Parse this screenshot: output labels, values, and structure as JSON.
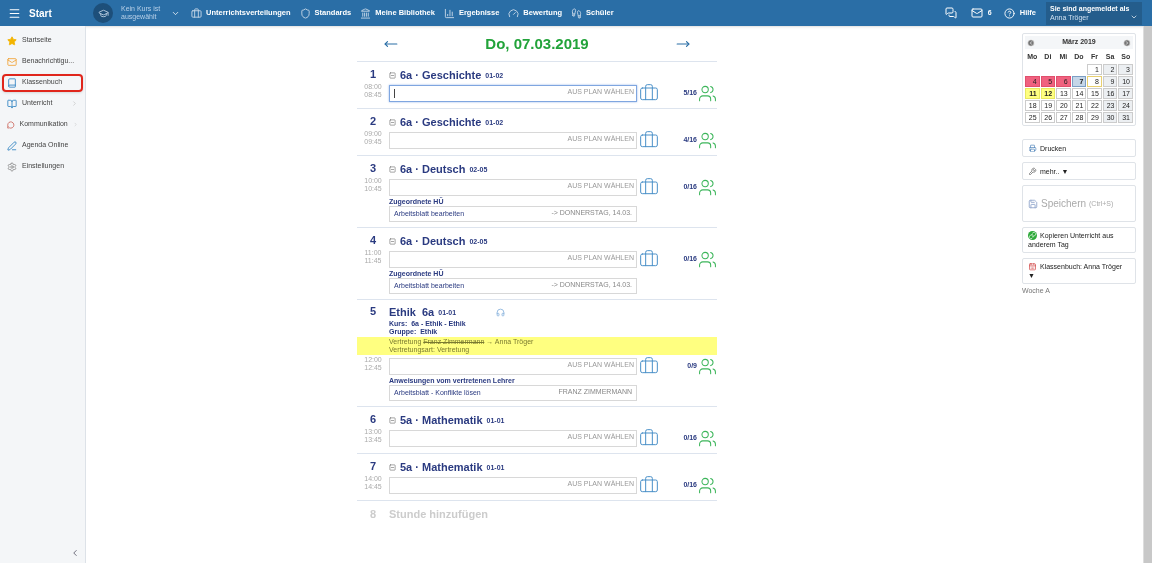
{
  "topbar": {
    "menu_label": "Start",
    "course_selector": "Kein Kurs ist ausgewählt",
    "nav": [
      {
        "label": "Unterrichtsverteilungen"
      },
      {
        "label": "Standards"
      },
      {
        "label": "Meine Bibliothek"
      },
      {
        "label": "Ergebnisse"
      },
      {
        "label": "Bewertung"
      },
      {
        "label": "Schüler"
      }
    ],
    "messages_count": "6",
    "help": "Hilfe",
    "user": {
      "caption": "Sie sind angemeldet als",
      "name": "Anna Tröger"
    }
  },
  "sidebar": {
    "items": [
      {
        "label": "Startseite",
        "selected": false,
        "has_submenu": false
      },
      {
        "label": "Benachrichtigu...",
        "selected": false,
        "has_submenu": false
      },
      {
        "label": "Klassenbuch",
        "selected": true,
        "has_submenu": false
      },
      {
        "label": "Unterricht",
        "selected": false,
        "has_submenu": true
      },
      {
        "label": "Kommunikation",
        "selected": false,
        "has_submenu": true
      },
      {
        "label": "Agenda Online",
        "selected": false,
        "has_submenu": false
      },
      {
        "label": "Einstellungen",
        "selected": false,
        "has_submenu": false
      }
    ]
  },
  "day": {
    "date": "Do, 07.03.2019"
  },
  "lessons": [
    {
      "kind": "regular",
      "number": "1",
      "start": "08:00",
      "end": "08:45",
      "title": "6a · Geschichte",
      "code": "01-02",
      "plan_placeholder": "AUS PLAN WÄHLEN",
      "focused": true,
      "attendance": "5/16"
    },
    {
      "kind": "regular",
      "number": "2",
      "start": "09:00",
      "end": "09:45",
      "title": "6a · Geschichte",
      "code": "01-02",
      "plan_placeholder": "AUS PLAN WÄHLEN",
      "focused": false,
      "attendance": "4/16"
    },
    {
      "kind": "regular",
      "number": "3",
      "start": "10:00",
      "end": "10:45",
      "title": "6a · Deutsch",
      "code": "02-05",
      "plan_placeholder": "AUS PLAN WÄHLEN",
      "focused": false,
      "attendance": "0/16",
      "homework": {
        "heading": "Zugeordnete HÜ",
        "text": "Arbeitsblatt bearbeiten",
        "due": "-> DONNERSTAG, 14.03."
      }
    },
    {
      "kind": "regular",
      "number": "4",
      "start": "11:00",
      "end": "11:45",
      "title": "6a · Deutsch",
      "code": "02-05",
      "plan_placeholder": "AUS PLAN WÄHLEN",
      "focused": false,
      "attendance": "0/16",
      "homework": {
        "heading": "Zugeordnete HÜ",
        "text": "Arbeitsblatt bearbeiten",
        "due": "-> DONNERSTAG, 14.03."
      }
    },
    {
      "kind": "substitution",
      "number": "5",
      "start": "12:00",
      "end": "12:45",
      "title": "Ethik  6a",
      "code": "01-01",
      "course_label": "Kurs:",
      "course": "6a - Ethik - Ethik",
      "group_label": "Gruppe:",
      "group": "Ethik",
      "substitution_label": "Vertretung",
      "original_teacher": "Franz Zimmermann",
      "arrow": "→",
      "new_teacher": "Anna Tröger",
      "type_label": "Vertretungsart:",
      "type": "Vertretung",
      "plan_placeholder": "AUS PLAN WÄHLEN",
      "focused": false,
      "attendance": "0/9",
      "instructions": {
        "heading": "Anweisungen vom vertretenen Lehrer",
        "text": "Arbeitsblatt - Konflikte lösen",
        "teacher": "FRANZ ZIMMERMANN"
      }
    },
    {
      "kind": "regular",
      "number": "6",
      "start": "13:00",
      "end": "13:45",
      "title": "5a · Mathematik",
      "code": "01-01",
      "plan_placeholder": "AUS PLAN WÄHLEN",
      "focused": false,
      "attendance": "0/16"
    },
    {
      "kind": "regular",
      "number": "7",
      "start": "14:00",
      "end": "14:45",
      "title": "5a · Mathematik",
      "code": "01-01",
      "plan_placeholder": "AUS PLAN WÄHLEN",
      "focused": false,
      "attendance": "0/16"
    }
  ],
  "add_lesson": {
    "number": "8",
    "label": "Stunde hinzufügen"
  },
  "calendar": {
    "month": "März 2019",
    "weekdays": [
      "Mo",
      "Di",
      "Mi",
      "Do",
      "Fr",
      "Sa",
      "So"
    ],
    "weeks": [
      [
        {
          "kind": "empty"
        },
        {
          "kind": "empty"
        },
        {
          "kind": "empty"
        },
        {
          "kind": "empty"
        },
        {
          "day": "1",
          "kind": "day"
        },
        {
          "day": "2",
          "kind": "weekend"
        },
        {
          "day": "3",
          "kind": "weekend"
        }
      ],
      [
        {
          "day": "4",
          "kind": "red"
        },
        {
          "day": "5",
          "kind": "red"
        },
        {
          "day": "6",
          "kind": "red"
        },
        {
          "day": "7",
          "kind": "selected"
        },
        {
          "day": "8",
          "kind": "today"
        },
        {
          "day": "9",
          "kind": "weekend"
        },
        {
          "day": "10",
          "kind": "weekend"
        }
      ],
      [
        {
          "day": "11",
          "kind": "yellow"
        },
        {
          "day": "12",
          "kind": "yellow"
        },
        {
          "day": "13",
          "kind": "day"
        },
        {
          "day": "14",
          "kind": "day"
        },
        {
          "day": "15",
          "kind": "day"
        },
        {
          "day": "16",
          "kind": "weekend"
        },
        {
          "day": "17",
          "kind": "weekend"
        }
      ],
      [
        {
          "day": "18",
          "kind": "day"
        },
        {
          "day": "19",
          "kind": "day"
        },
        {
          "day": "20",
          "kind": "day"
        },
        {
          "day": "21",
          "kind": "day"
        },
        {
          "day": "22",
          "kind": "day"
        },
        {
          "day": "23",
          "kind": "weekend"
        },
        {
          "day": "24",
          "kind": "weekend"
        }
      ],
      [
        {
          "day": "25",
          "kind": "day"
        },
        {
          "day": "26",
          "kind": "day"
        },
        {
          "day": "27",
          "kind": "day"
        },
        {
          "day": "28",
          "kind": "day"
        },
        {
          "day": "29",
          "kind": "day"
        },
        {
          "day": "30",
          "kind": "weekend"
        },
        {
          "day": "31",
          "kind": "weekend"
        }
      ]
    ]
  },
  "actions": [
    {
      "kind": "print",
      "label": "Drucken",
      "disabled": false
    },
    {
      "kind": "more",
      "label": "mehr..",
      "caret": "▼",
      "disabled": false
    },
    {
      "kind": "save",
      "label": "Speichern",
      "shortcut": "(Ctrl+S)",
      "disabled": true
    },
    {
      "kind": "copy",
      "label": "Kopieren Unterricht aus anderem Tag",
      "disabled": false
    },
    {
      "kind": "classbook",
      "label": "Klassenbuch: Anna Tröger",
      "caret": "▼",
      "disabled": false
    }
  ],
  "week_label": "Woche A"
}
